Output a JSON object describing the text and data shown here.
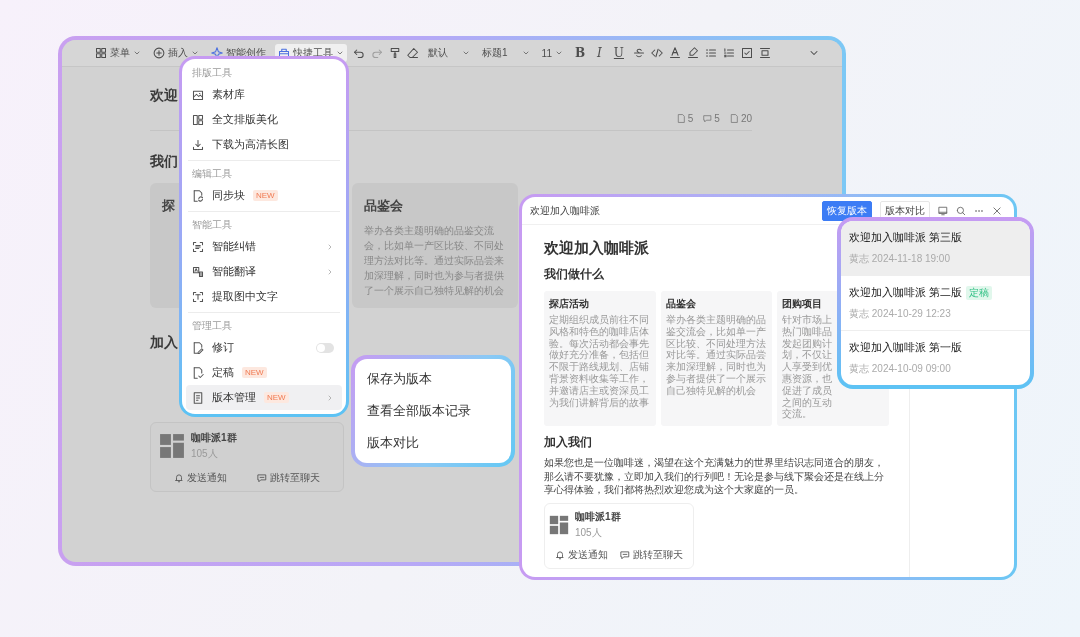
{
  "editor": {
    "toolbar": {
      "menu": "菜单",
      "insert": "插入",
      "ai_write": "智能创作",
      "quick_tools": {
        "label": "快捷工具",
        "selected": true
      },
      "font_style": "默认",
      "heading": "标题1",
      "font_size": "11",
      "format_buttons": [
        "B",
        "I",
        "U"
      ]
    },
    "document": {
      "title": "欢迎",
      "stats": [
        "5",
        "5",
        "20"
      ],
      "section_heading": "我们",
      "cards": [
        {
          "title": "探"
        },
        {
          "title": "品鉴会",
          "text": "举办各类主题明确的品鉴交流会，比如单一产区比较、不同处理方法对比等。通过实际品尝来加深理解，同时也为参与者提供了一个展示自己独特见解的机会"
        }
      ],
      "join_heading": "加入",
      "group": {
        "name": "咖啡派1群",
        "members": "105人",
        "actions": [
          "发送通知",
          "跳转至聊天"
        ]
      }
    }
  },
  "quick_menu": {
    "sections": [
      {
        "title": "排版工具",
        "items": [
          {
            "label": "素材库",
            "kind": "plain",
            "selected": false
          },
          {
            "label": "全文排版美化",
            "kind": "plain",
            "selected": false
          },
          {
            "label": "下载为高清长图",
            "kind": "plain",
            "selected": false
          }
        ]
      },
      {
        "title": "编辑工具",
        "items": [
          {
            "label": "同步块",
            "kind": "plain",
            "badge": "NEW",
            "selected": false
          }
        ]
      },
      {
        "title": "智能工具",
        "items": [
          {
            "label": "智能纠错",
            "kind": "submenu",
            "selected": false
          },
          {
            "label": "智能翻译",
            "kind": "submenu",
            "selected": false
          },
          {
            "label": "提取图中文字",
            "kind": "plain",
            "selected": false
          }
        ]
      },
      {
        "title": "管理工具",
        "items": [
          {
            "label": "修订",
            "kind": "toggle",
            "on": false,
            "selected": false
          },
          {
            "label": "定稿",
            "kind": "plain",
            "badge": "NEW",
            "selected": false
          },
          {
            "label": "版本管理",
            "kind": "submenu",
            "badge": "NEW",
            "selected": true
          }
        ]
      }
    ]
  },
  "version_submenu": {
    "items": [
      "保存为版本",
      "查看全部版本记录",
      "版本对比"
    ]
  },
  "preview_window": {
    "title": "欢迎加入咖啡派",
    "buttons": [
      {
        "label": "恢复版本",
        "kind": "primary"
      },
      {
        "label": "版本对比",
        "kind": "secondary"
      }
    ],
    "heading": "欢迎加入咖啡派",
    "section_heading": "我们做什么",
    "cards": [
      {
        "title": "探店活动",
        "text": "定期组织成员前往不同风格和特色的咖啡店体验。每次活动都会事先做好充分准备，包括但不限于路线规划、店铺背景资料收集等工作，并邀请店主或资深员工为我们讲解背后的故事"
      },
      {
        "title": "品鉴会",
        "text": "举办各类主题明确的品鉴交流会，比如单一产区比较、不同处理方法对比等。通过实际品尝来加深理解，同时也为参与者提供了一个展示自己独特见解的机会"
      },
      {
        "title": "团购项目",
        "text": "针对市场上热门咖啡品发起团购计划，不仅让人享受到优惠资源，也促进了成员之间的互动交流。"
      }
    ],
    "join_heading": "加入我们",
    "join_text": "如果您也是一位咖啡迷，渴望在这个充满魅力的世界里结识志同道合的朋友，那么请不要犹豫，立即加入我们的行列吧！无论是参与线下聚会还是在线上分享心得体验，我们都将热烈欢迎您成为这个大家庭的一员。",
    "group": {
      "name": "咖啡派1群",
      "members": "105人",
      "actions": [
        "发送通知",
        "跳转至聊天"
      ]
    }
  },
  "version_list": {
    "items": [
      {
        "title": "欢迎加入咖啡派 第三版",
        "meta": "黄志 2024-11-18 19:00",
        "selected": true
      },
      {
        "title": "欢迎加入咖啡派 第二版",
        "badge": "定稿",
        "meta": "黄志 2024-10-29 12:23",
        "selected": false
      },
      {
        "title": "欢迎加入咖啡派 第一版",
        "meta": "黄志 2024-10-09 09:00",
        "selected": false
      }
    ]
  }
}
